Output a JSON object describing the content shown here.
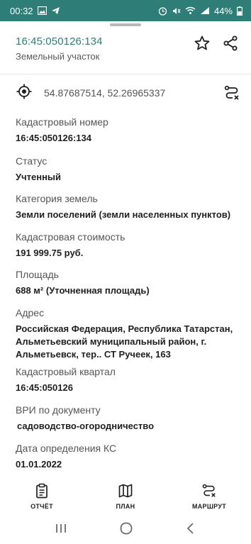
{
  "status_bar": {
    "time": "00:32",
    "battery": "44%",
    "bg_color": "#2e7d76"
  },
  "header": {
    "cadastral_number": "16:45:050126:134",
    "object_type": "Земельный участок"
  },
  "coordinates": "54.87687514, 52.26965337",
  "fields": [
    {
      "label": "Кадастровый номер",
      "value": "16:45:050126:134"
    },
    {
      "label": "Статус",
      "value": "Учтенный"
    },
    {
      "label": "Категория земель",
      "value": "Земли поселений (земли населенных пунктов)"
    },
    {
      "label": "Кадастровая стоимость",
      "value": "191 999.75 руб."
    },
    {
      "label": "Площадь",
      "value": "688 м² (Уточненная площадь)"
    },
    {
      "label": "Адрес",
      "value_lines": [
        "Российская Федерация, Республика Татарстан,",
        "Альметьевский муниципальный район, г.",
        "Альметьевск, тер.. СТ Ручеек, 163"
      ]
    },
    {
      "label": "Кадастровый квартал",
      "value": "16:45:050126"
    },
    {
      "label": "ВРИ по документу",
      "value": "садоводство-огородничество"
    },
    {
      "label": "Дата определения КС",
      "value": "01.01.2022"
    }
  ],
  "bottom_nav": [
    {
      "label": "ОТЧЁТ",
      "icon": "clipboard-icon"
    },
    {
      "label": "ПЛАН",
      "icon": "map-icon"
    },
    {
      "label": "МАРШРУТ",
      "icon": "route-icon"
    }
  ],
  "icons": {
    "target": "crosshair-icon",
    "favorite": "star-icon",
    "share": "share-icon",
    "route": "route-icon"
  }
}
